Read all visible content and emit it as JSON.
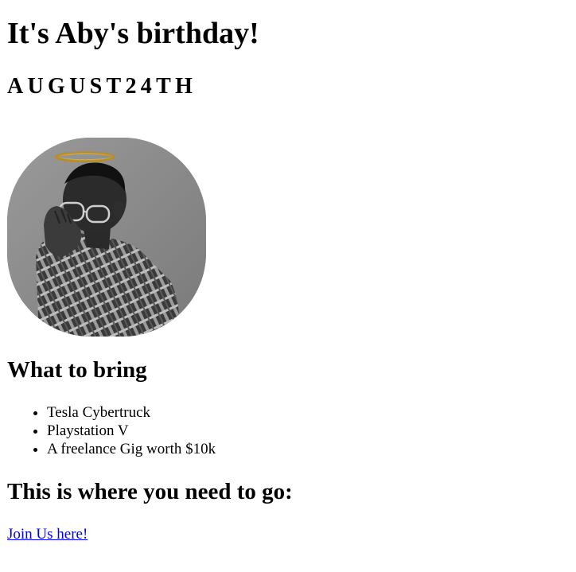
{
  "header": {
    "title": "It's Aby's birthday!",
    "date": "AUGUST24TH"
  },
  "photo": {
    "icon": "portrait-photo-with-halo"
  },
  "bring": {
    "heading": "What to bring",
    "items": [
      {
        "label": "Tesla Cybertruck"
      },
      {
        "label": "Playstation V"
      },
      {
        "label": "A freelance Gig worth $10k"
      }
    ]
  },
  "directions": {
    "heading": "This is where you need to go:",
    "link_label": "Join Us here!"
  },
  "colors": {
    "link": "#0000ee",
    "text": "#000000",
    "halo": "#d9b44a"
  }
}
